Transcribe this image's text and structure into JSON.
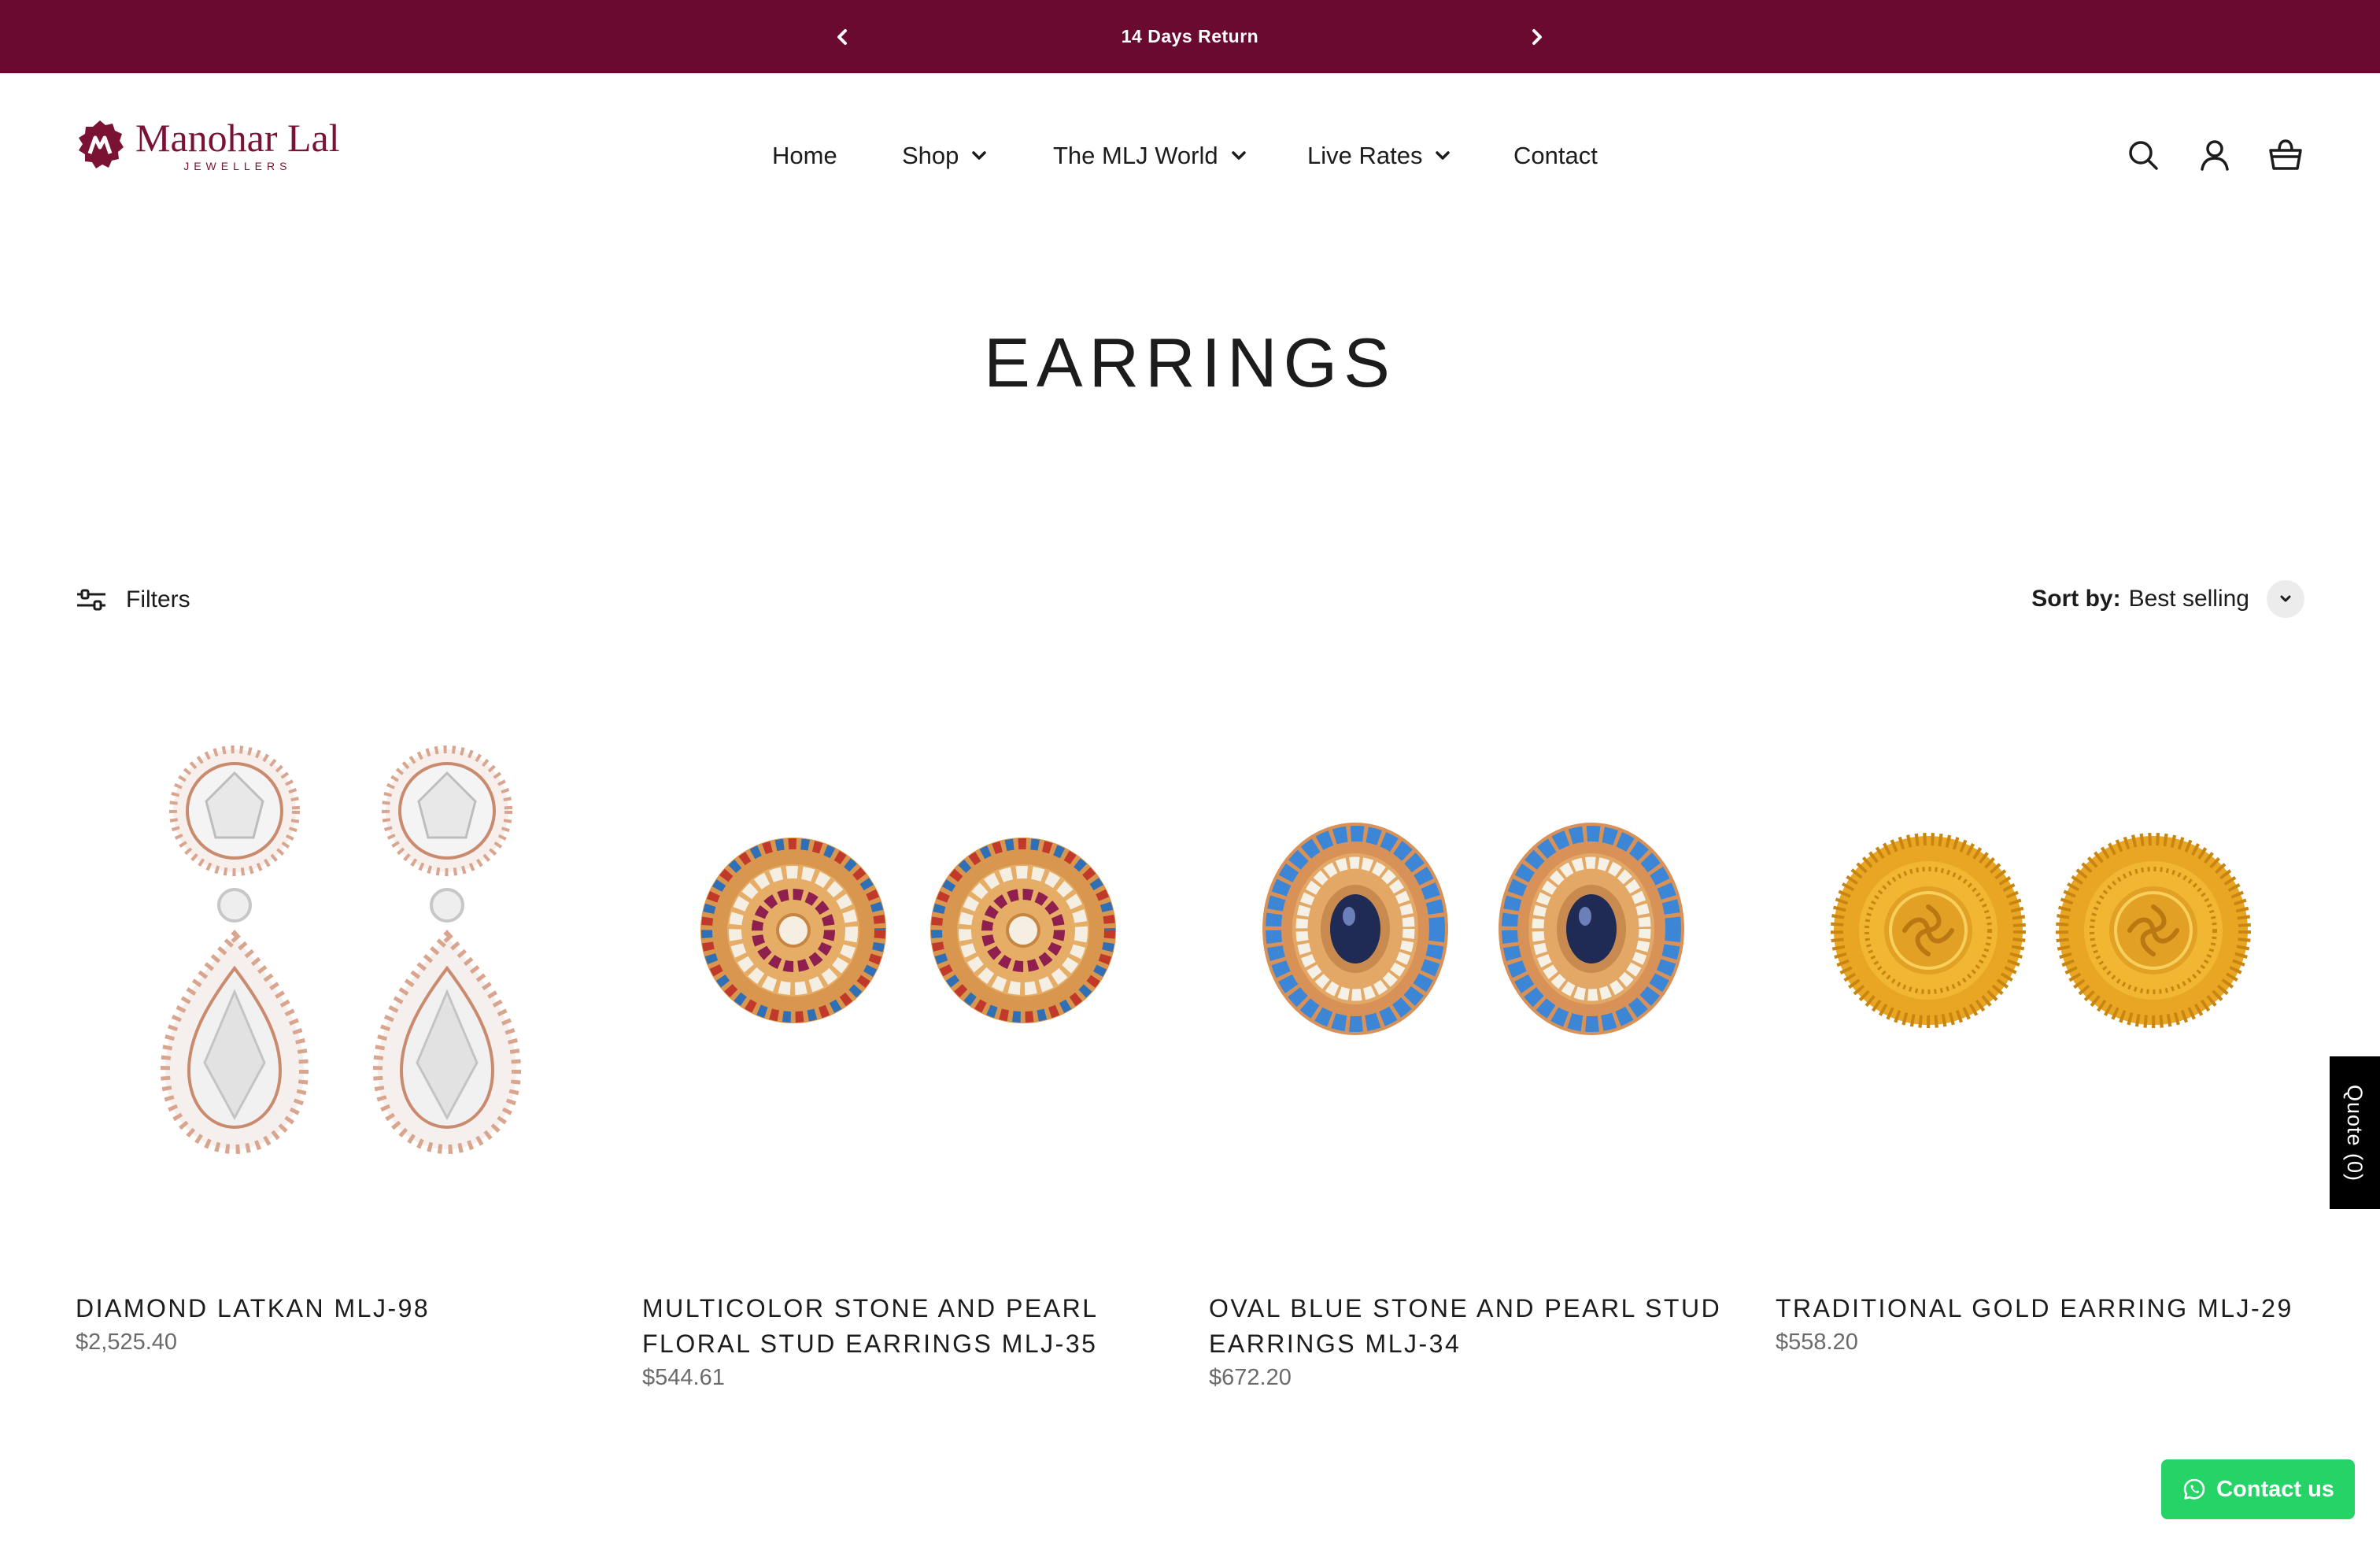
{
  "announcement": {
    "text": "14 Days Return",
    "prev_icon": "chevron-left-icon",
    "next_icon": "chevron-right-icon"
  },
  "brand": {
    "name": "Manohar Lal",
    "tagline": "JEWELLERS",
    "color": "#7a1233"
  },
  "nav": {
    "home": "Home",
    "shop": "Shop",
    "mlj_world": "The MLJ World",
    "live_rates": "Live Rates",
    "contact": "Contact"
  },
  "header_icons": [
    "search-icon",
    "account-icon",
    "cart-icon"
  ],
  "page": {
    "title": "EARRINGS"
  },
  "toolbar": {
    "filters_label": "Filters",
    "sort_key": "Sort by:",
    "sort_value": "Best selling"
  },
  "products": [
    {
      "name": "DIAMOND LATKAN MLJ-98",
      "price": "$2,525.40"
    },
    {
      "name": "MULTICOLOR STONE AND PEARL FLORAL STUD EARRINGS MLJ-35",
      "price": "$544.61"
    },
    {
      "name": "OVAL BLUE STONE AND PEARL STUD EARRINGS MLJ-34",
      "price": "$672.20"
    },
    {
      "name": "TRADITIONAL GOLD EARRING MLJ-29",
      "price": "$558.20"
    }
  ],
  "quote": {
    "label": "Quote (0)"
  },
  "contact_widget": {
    "label": "Contact us",
    "color": "#25d366"
  },
  "colors": {
    "announcement_bg": "#6a0a30",
    "text": "#1c1c1c",
    "price": "#6b6b6b"
  }
}
